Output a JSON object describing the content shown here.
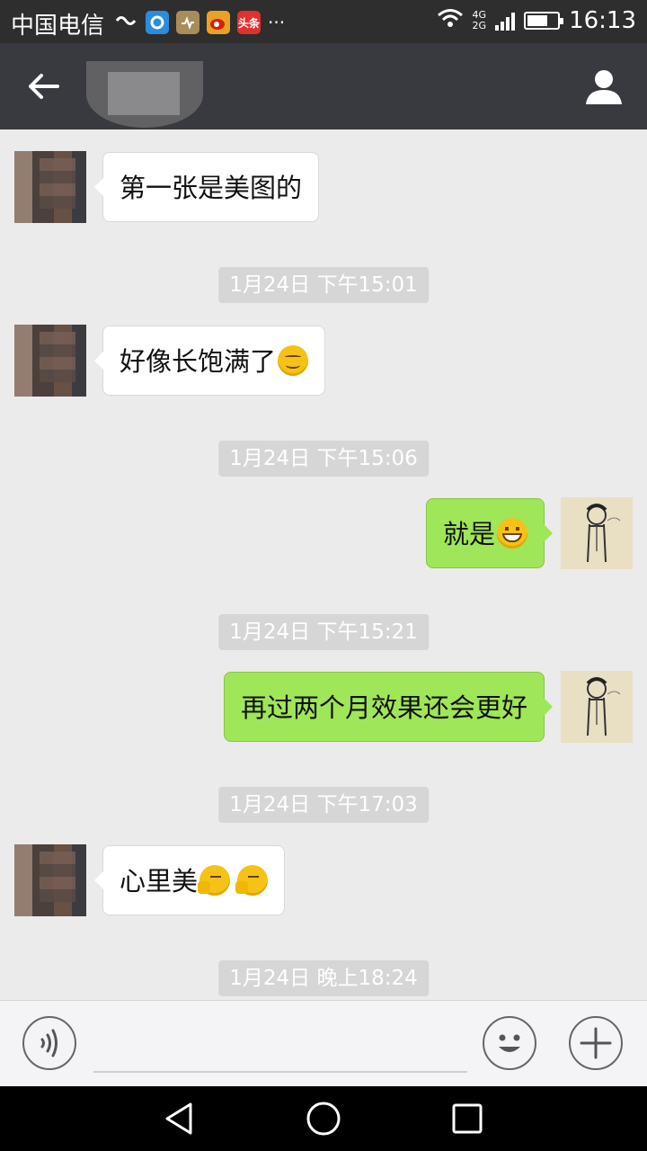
{
  "status_bar": {
    "carrier": "中国电信",
    "time": "16:13",
    "network_4g": "4G",
    "network_2g": "2G",
    "notification_icons": [
      "wave-icon",
      "qq-browser-icon",
      "health-app-icon",
      "weibo-icon",
      "toutiao-icon",
      "more-icon"
    ],
    "toutiao_label": "头条",
    "more": "···",
    "battery_level": 0.7
  },
  "title_bar": {
    "back_icon": "arrow-left-icon",
    "profile_icon": "person-icon"
  },
  "messages": [
    {
      "side": "left",
      "text": "第一张是美图的",
      "emoji": []
    },
    {
      "timestamp": "1月24日 下午15:01"
    },
    {
      "side": "left",
      "text": "好像长饱满了",
      "emoji": [
        "smile"
      ]
    },
    {
      "timestamp": "1月24日 下午15:06"
    },
    {
      "side": "right",
      "text": "就是",
      "emoji": [
        "grin"
      ]
    },
    {
      "timestamp": "1月24日 下午15:21"
    },
    {
      "side": "right",
      "text": "再过两个月效果还会更好",
      "emoji": []
    },
    {
      "timestamp": "1月24日 下午17:03"
    },
    {
      "side": "left",
      "text": "心里美",
      "emoji": [
        "think",
        "think"
      ]
    },
    {
      "timestamp": "1月24日 晚上18:24"
    }
  ],
  "input_bar": {
    "voice_icon": "voice-icon",
    "emoji_icon": "emoji-face-icon",
    "plus_icon": "plus-icon",
    "input_value": ""
  },
  "nav_bar": {
    "icons": [
      "back-triangle-icon",
      "home-circle-icon",
      "recents-square-icon"
    ]
  },
  "colors": {
    "title_bg": "#393a3f",
    "chat_bg": "#ebebeb",
    "my_bubble": "#9fe658",
    "their_bubble": "#ffffff",
    "timestamp_bg": "#d6d6d6"
  }
}
